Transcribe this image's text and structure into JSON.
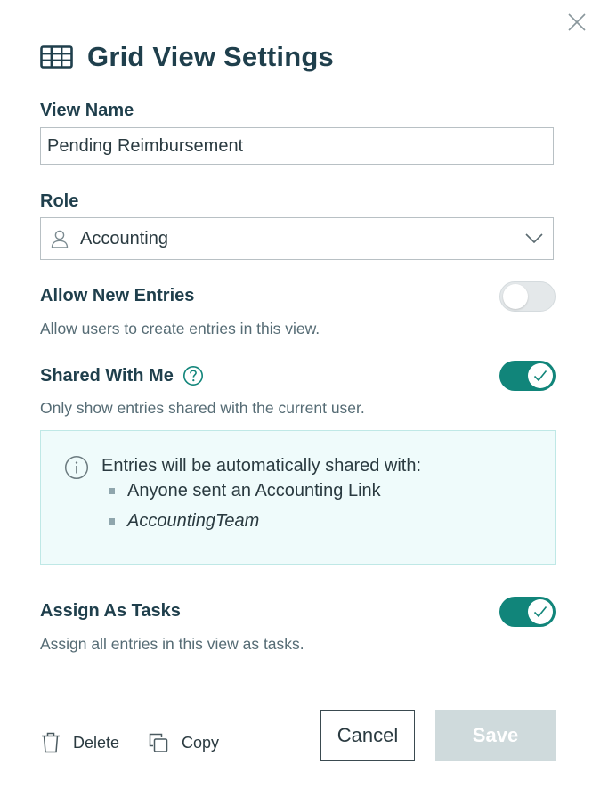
{
  "dialog": {
    "title": "Grid View Settings",
    "title_icon": "grid-table-icon",
    "close_icon": "close-icon"
  },
  "view_name": {
    "label": "View Name",
    "value": "Pending Reimbursement"
  },
  "role": {
    "label": "Role",
    "value": "Accounting",
    "icon": "person-icon"
  },
  "allow_new_entries": {
    "label": "Allow New Entries",
    "description": "Allow users to create entries in this view.",
    "enabled": false
  },
  "shared_with_me": {
    "label": "Shared With Me",
    "description": "Only show entries shared with the current user.",
    "enabled": true,
    "help_icon": "question-circle-icon"
  },
  "share_info": {
    "message": "Entries will be automatically shared with:",
    "items": [
      "Anyone sent an Accounting Link",
      "AccountingTeam"
    ]
  },
  "assign_as_tasks": {
    "label": "Assign As Tasks",
    "description": "Assign all entries in this view as tasks.",
    "enabled": true
  },
  "footer": {
    "delete_label": "Delete",
    "copy_label": "Copy",
    "cancel_label": "Cancel",
    "save_label": "Save"
  },
  "colors": {
    "accent": "#11857a",
    "heading": "#1f3f4c",
    "info_bg": "#effbfb",
    "save_disabled": "#cfdadc"
  }
}
